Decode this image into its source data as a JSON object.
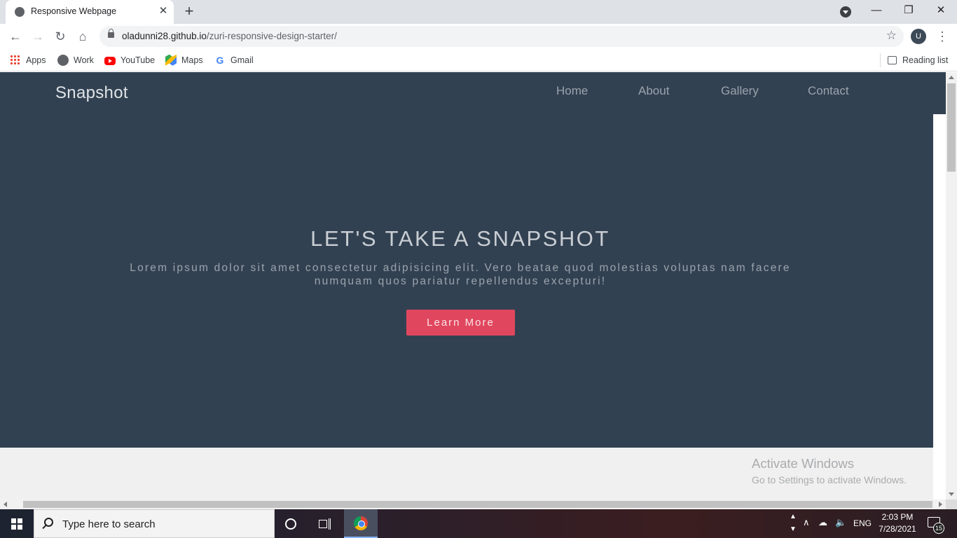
{
  "browser": {
    "tab": {
      "title": "Responsive Webpage",
      "close": "✕"
    },
    "new_tab": "+",
    "window_controls": {
      "minimize": "—",
      "maximize": "❐",
      "close": "✕"
    },
    "url": {
      "host": "oladunni28.github.io",
      "path": "/zuri-responsive-design-starter/"
    },
    "profile_initial": "U",
    "nav_icons": {
      "back": "←",
      "forward": "→",
      "reload": "↻",
      "home": "⌂",
      "star": "☆",
      "menu": "⋮"
    },
    "bookmarks": [
      {
        "label": "Apps",
        "icon": "apps-icon"
      },
      {
        "label": "Work",
        "icon": "globe-icon"
      },
      {
        "label": "YouTube",
        "icon": "youtube-icon"
      },
      {
        "label": "Maps",
        "icon": "maps-icon"
      },
      {
        "label": "Gmail",
        "icon": "google-icon",
        "glyph": "G"
      }
    ],
    "reading_list": "Reading list"
  },
  "page": {
    "brand": "Snapshot",
    "nav": [
      "Home",
      "About",
      "Gallery",
      "Contact"
    ],
    "hero": {
      "title": "LET'S TAKE A SNAPSHOT",
      "text": "Lorem ipsum dolor sit amet consectetur adipisicing elit. Vero beatae quod molestias voluptas nam facere numquam quos pariatur repellendus excepturi!",
      "button": "Learn More"
    },
    "colors": {
      "hero_bg": "#324151",
      "accent": "#e0475e"
    }
  },
  "watermark": {
    "line1": "Activate Windows",
    "line2": "Go to Settings to activate Windows."
  },
  "taskbar": {
    "search_placeholder": "Type here to search",
    "tray": {
      "language": "ENG",
      "time": "2:03 PM",
      "date": "7/28/2021",
      "notifications": "15"
    }
  }
}
